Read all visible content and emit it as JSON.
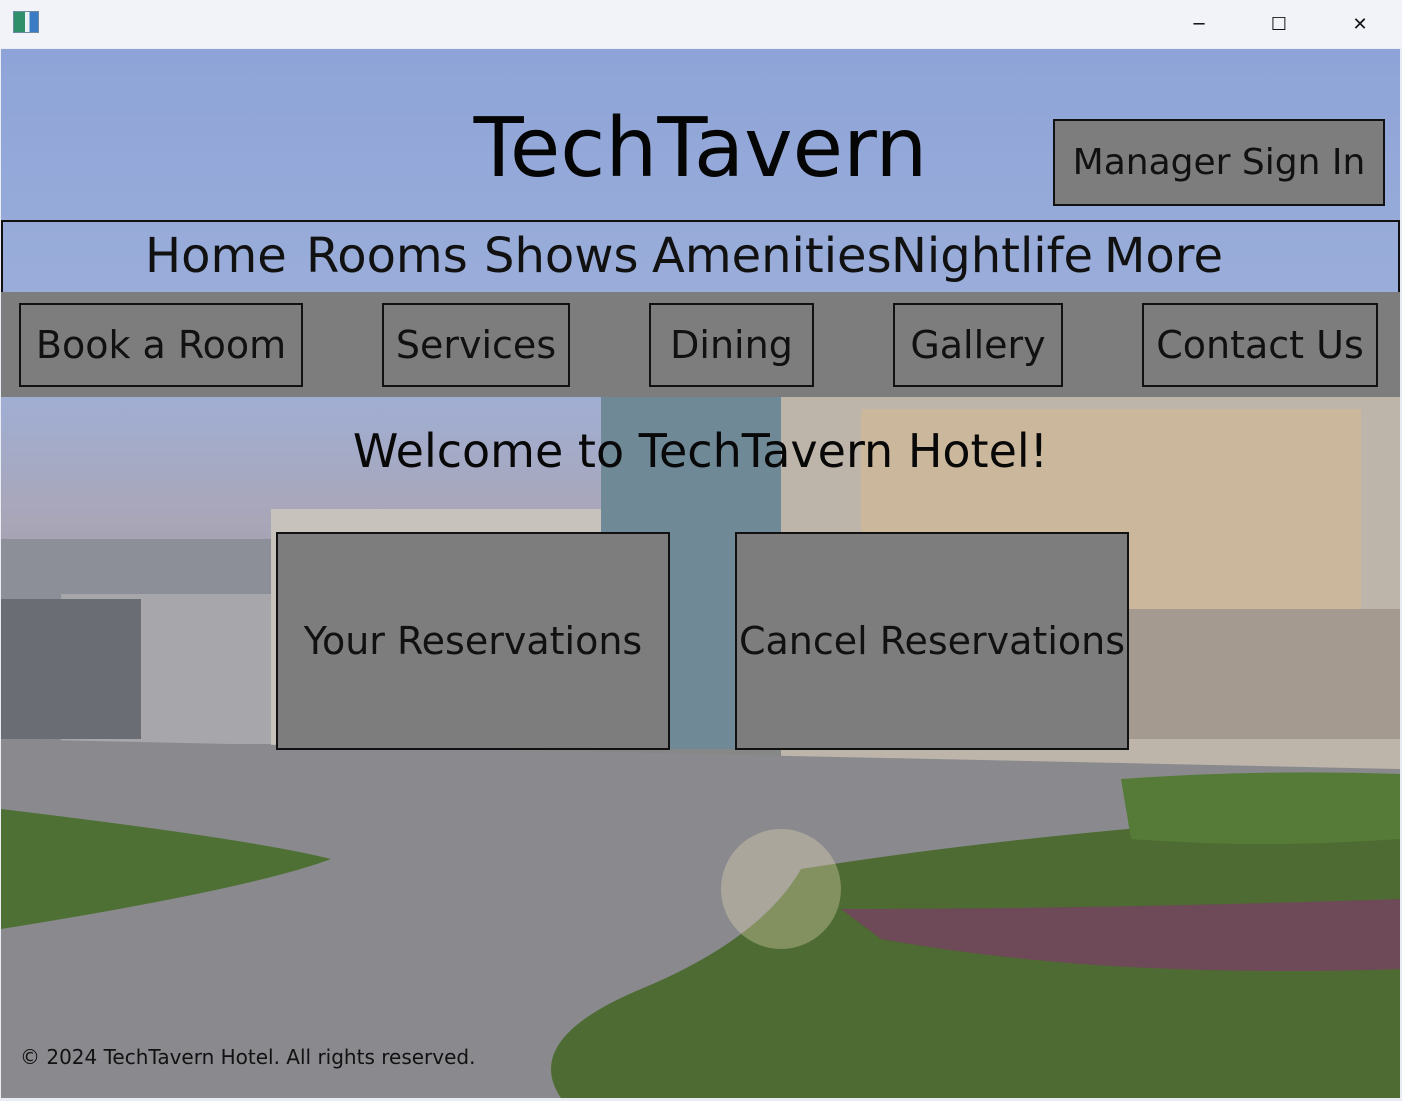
{
  "window": {
    "icon": "app-icon",
    "controls": {
      "minimize": "─",
      "maximize": "☐",
      "close": "✕"
    }
  },
  "header": {
    "title": "TechTavern",
    "manager_sign_in": "Manager Sign In"
  },
  "nav": {
    "items": [
      {
        "label": "Home"
      },
      {
        "label": "Rooms"
      },
      {
        "label": "Shows"
      },
      {
        "label": "Amenities"
      },
      {
        "label": "Nightlife"
      },
      {
        "label": "More"
      }
    ]
  },
  "actions": {
    "items": [
      {
        "label": "Book a Room"
      },
      {
        "label": "Services"
      },
      {
        "label": "Dining"
      },
      {
        "label": "Gallery"
      },
      {
        "label": "Contact Us"
      }
    ]
  },
  "main": {
    "welcome": "Welcome to TechTavern Hotel!",
    "your_reservations": "Your Reservations",
    "cancel_reservations": "Cancel Reservations"
  },
  "footer": {
    "copyright": "© 2024 TechTavern Hotel. All rights reserved."
  },
  "colors": {
    "button_gray": "#7d7d7d",
    "border": "#111111",
    "titlebar": "#f2f3f9"
  }
}
